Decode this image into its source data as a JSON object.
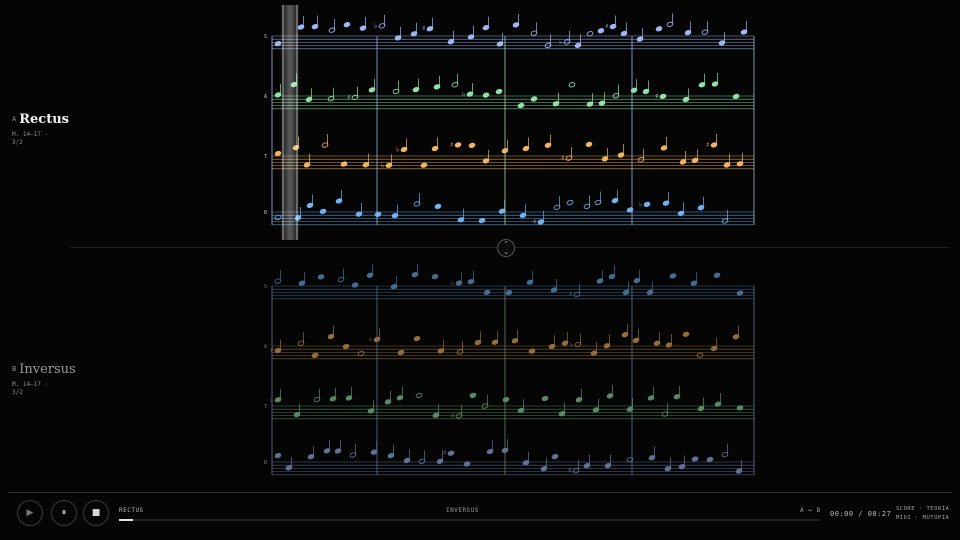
{
  "panels": [
    {
      "letter": "A",
      "title": "Rectus",
      "measures": "M. 14–17 ·",
      "meter": "3/2"
    },
    {
      "letter": "B",
      "title": "Inversus",
      "measures": "M. 14–17 ·",
      "meter": "3/2"
    }
  ],
  "staff_letters_a": [
    "S",
    "A",
    "T",
    "B"
  ],
  "staff_letters_b": [
    "S",
    "A",
    "T",
    "B"
  ],
  "swap": {
    "up": "⌃",
    "down": "⌄"
  },
  "transport": {
    "play": "▶",
    "pause": "⏸",
    "stop": "■"
  },
  "timeline": {
    "label_a": "RECTUS",
    "label_b": "INVERSUS",
    "label_right": "A ↔ B",
    "progress": 0.02
  },
  "time": "00:00 / 00:27",
  "credits": [
    "SCORE · TEORÍA",
    "MIDI · MUTOPIA"
  ],
  "colors": {
    "soprano": "#9fb7f5",
    "alto": "#8fe3a6",
    "tenor": "#f3b45e",
    "bass": "#6fb2f0",
    "background": "#050505"
  }
}
